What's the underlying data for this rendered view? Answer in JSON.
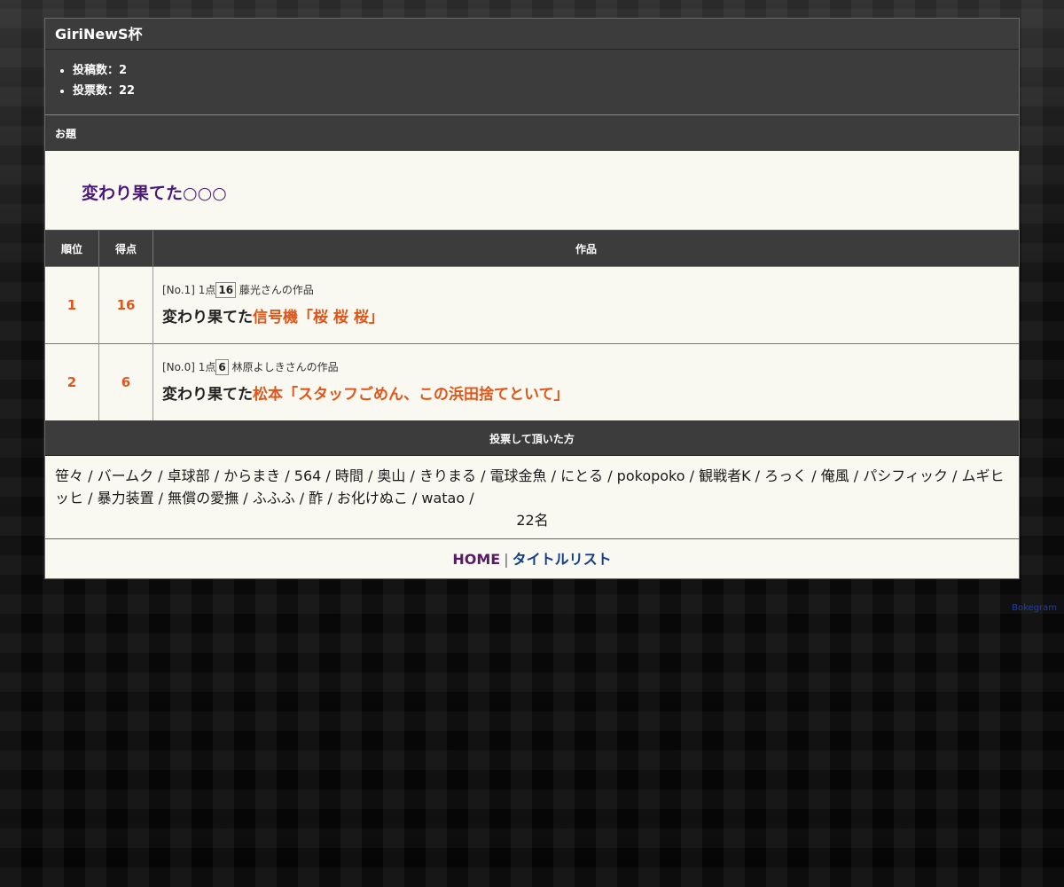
{
  "header": {
    "title": "GiriNewS杯"
  },
  "stats": [
    {
      "label": "投稿数：2"
    },
    {
      "label": "投票数：22"
    }
  ],
  "theme": {
    "heading": "お題",
    "text": "変わり果てた○○○"
  },
  "ranking": {
    "headers": {
      "rank": "順位",
      "score": "得点",
      "work": "作品"
    },
    "rows": [
      {
        "rank": "1",
        "score": "16",
        "meta_prefix": "[No.1] 1点",
        "votes": "16",
        "author": "藤光さんの作品",
        "lead": "変わり果てた",
        "answer": "信号機「桜 桜 桜」"
      },
      {
        "rank": "2",
        "score": "6",
        "meta_prefix": "[No.0] 1点",
        "votes": "6",
        "author": "林原よしきさんの作品",
        "lead": "変わり果てた",
        "answer": "松本「スタッフごめん、この浜田捨てといて」"
      }
    ]
  },
  "voters": {
    "heading": "投票して頂いた方",
    "list": "笹々 / バームク / 卓球部 / からまき / 564 / 時間 / 奥山 / きりまる / 電球金魚 / にとる / pokopoko / 観戦者K / ろっく / 俺風 / パシフィック / ムギヒッヒ / 暴力装置 / 無償の愛撫 / ふふふ / 酢 / お化けぬこ / watao /",
    "count": "22名"
  },
  "footer": {
    "home": "HOME",
    "separator": "|",
    "title_list": "タイトルリスト"
  },
  "credit": "Bokegram",
  "colors": {
    "accent": "#e0561a",
    "theme_text": "#4a1a78",
    "header_bg": "#3c3c3c",
    "panel_bg": "#faf9f1"
  }
}
